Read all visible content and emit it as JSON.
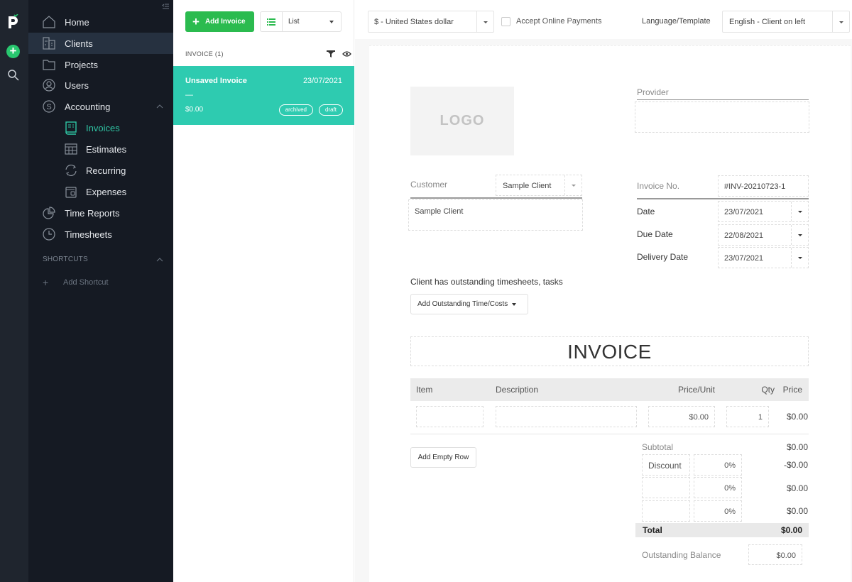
{
  "sidebar": {
    "items": [
      {
        "label": "Home"
      },
      {
        "label": "Clients"
      },
      {
        "label": "Projects"
      },
      {
        "label": "Users"
      },
      {
        "label": "Accounting"
      },
      {
        "label": "Invoices"
      },
      {
        "label": "Estimates"
      },
      {
        "label": "Recurring"
      },
      {
        "label": "Expenses"
      },
      {
        "label": "Time Reports"
      },
      {
        "label": "Timesheets"
      }
    ],
    "shortcuts_title": "SHORTCUTS",
    "add_shortcut": "Add Shortcut"
  },
  "list": {
    "add_button": "Add Invoice",
    "view_mode": "List",
    "header": "INVOICE (1)",
    "items": [
      {
        "title": "Unsaved Invoice",
        "date": "23/07/2021",
        "subtitle": "—",
        "amount": "$0.00",
        "badges": [
          "archived",
          "draft"
        ]
      }
    ]
  },
  "toolbar": {
    "currency": "$ - United States dollar",
    "accept_online_payments": "Accept Online Payments",
    "accept_online_checked": false,
    "language_label": "Language/Template",
    "language_value": "English - Client on left"
  },
  "invoice": {
    "logo_text": "LOGO",
    "provider_label": "Provider",
    "customer_label": "Customer",
    "customer_select": "Sample Client",
    "customer_text": "Sample Client",
    "invoice_no_label": "Invoice No.",
    "invoice_no": "#INV-20210723-1",
    "date_label": "Date",
    "date": "23/07/2021",
    "due_date_label": "Due Date",
    "due_date": "22/08/2021",
    "delivery_date_label": "Delivery Date",
    "delivery_date": "23/07/2021",
    "outstanding_notice": "Client has outstanding timesheets, tasks",
    "outstanding_button": "Add Outstanding Time/Costs",
    "title": "INVOICE",
    "columns": [
      "Item",
      "Description",
      "Price/Unit",
      "Qty",
      "Price"
    ],
    "rows": [
      {
        "item": "",
        "description": "",
        "price_unit": "$0.00",
        "qty": "1",
        "price": "$0.00"
      }
    ],
    "add_row_button": "Add Empty Row",
    "subtotal_label": "Subtotal",
    "subtotal": "$0.00",
    "adjustments": [
      {
        "name": "Discount",
        "percent": "0%",
        "amount": "-$0.00"
      },
      {
        "name": "",
        "percent": "0%",
        "amount": "$0.00"
      },
      {
        "name": "",
        "percent": "0%",
        "amount": "$0.00"
      }
    ],
    "total_label": "Total",
    "total": "$0.00",
    "balance_label": "Outstanding Balance",
    "balance": "$0.00"
  },
  "colors": {
    "accent": "#2ecbb0",
    "primary_button": "#2bbb4f",
    "sidebar_bg": "#151a23"
  }
}
